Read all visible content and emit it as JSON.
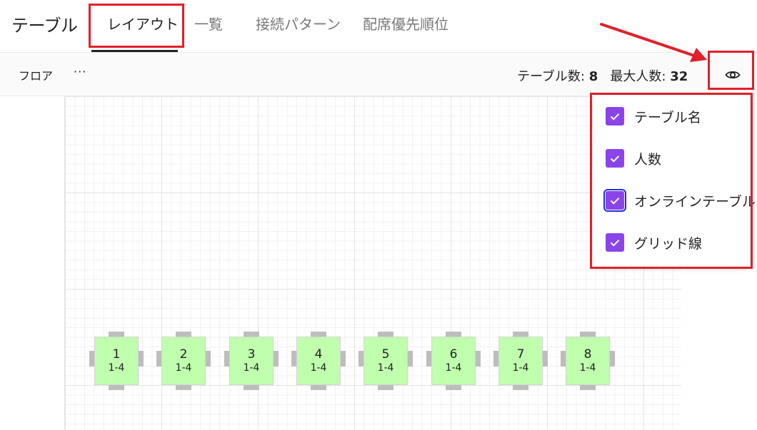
{
  "header": {
    "title": "テーブル",
    "tabs": [
      {
        "label": "レイアウト",
        "active": true
      },
      {
        "label": "一覧"
      },
      {
        "label": "接続パターン"
      },
      {
        "label": "配席優先順位"
      }
    ]
  },
  "toolbar": {
    "floor_label": "フロア",
    "more_label": "···",
    "table_count_label": "テーブル数:",
    "table_count": "8",
    "max_people_label": "最大人数:",
    "max_people": "32",
    "visibility_icon": "eye-icon"
  },
  "view_options": [
    {
      "label": "テーブル名",
      "checked": true
    },
    {
      "label": "人数",
      "checked": true
    },
    {
      "label": "オンラインテーブル",
      "checked": true,
      "focused": true
    },
    {
      "label": "グリッド線",
      "checked": true
    }
  ],
  "tables": [
    {
      "name": "1",
      "capacity": "1-4"
    },
    {
      "name": "2",
      "capacity": "1-4"
    },
    {
      "name": "3",
      "capacity": "1-4"
    },
    {
      "name": "4",
      "capacity": "1-4"
    },
    {
      "name": "5",
      "capacity": "1-4"
    },
    {
      "name": "6",
      "capacity": "1-4"
    },
    {
      "name": "7",
      "capacity": "1-4"
    },
    {
      "name": "8",
      "capacity": "1-4"
    }
  ],
  "colors": {
    "table_fill": "#bfffad",
    "checkbox": "#8b44e8",
    "annotation": "#e0202a"
  }
}
